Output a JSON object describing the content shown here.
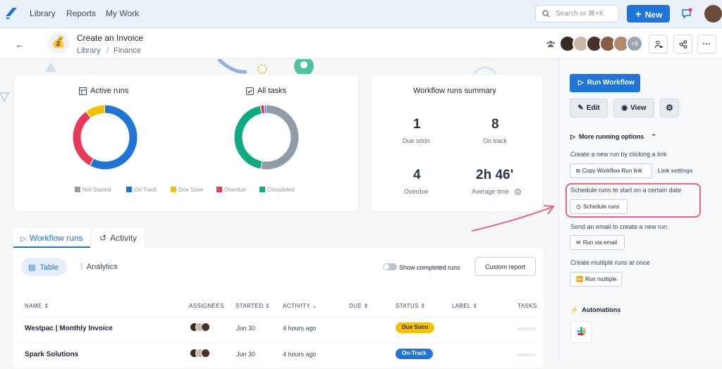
{
  "topbar": {
    "nav": [
      "Library",
      "Reports",
      "My Work"
    ],
    "search_placeholder": "Search or ⌘+K",
    "new_label": "New"
  },
  "workflow": {
    "title": "Create an Invoice",
    "breadcrumb_root": "Library",
    "breadcrumb_sep": "/",
    "breadcrumb_leaf": "Finance",
    "extra_assignees": "+6"
  },
  "active_runs": {
    "title": "Active runs",
    "segments": [
      {
        "status": "On Track",
        "fraction": 0.58,
        "color": "#1f74d8"
      },
      {
        "status": "Overdue",
        "fraction": 0.32,
        "color": "#e8385a"
      },
      {
        "status": "Due Soon",
        "fraction": 0.1,
        "color": "#f6c000"
      }
    ]
  },
  "all_tasks": {
    "title": "All tasks",
    "segments": [
      {
        "status": "Not Started",
        "fraction": 0.53,
        "color": "#919ca9"
      },
      {
        "status": "Completed",
        "fraction": 0.44,
        "color": "#0faa84"
      },
      {
        "status": "Overdue",
        "fraction": 0.02,
        "color": "#e8385a"
      },
      {
        "status": "On Track",
        "fraction": 0.01,
        "color": "#1f74d8"
      }
    ]
  },
  "legend": [
    {
      "label": "Not Started",
      "color": "#919ca9"
    },
    {
      "label": "On Track",
      "color": "#1f74d8"
    },
    {
      "label": "Due Soon",
      "color": "#f6c000"
    },
    {
      "label": "Overdue",
      "color": "#e8385a"
    },
    {
      "label": "Completed",
      "color": "#0faa84"
    }
  ],
  "summary": {
    "title": "Workflow runs summary",
    "due_soon": {
      "value": "1",
      "label": "Due soon"
    },
    "on_track": {
      "value": "8",
      "label": "On track"
    },
    "overdue": {
      "value": "4",
      "label": "Overdue"
    },
    "average": {
      "value": "2h 46'",
      "label": "Average time"
    }
  },
  "tabs": {
    "runs": "Workflow runs",
    "activity": "Activity"
  },
  "toolbar": {
    "table": "Table",
    "analytics": "Analytics",
    "show_completed": "Show completed runs",
    "custom_report": "Custom report"
  },
  "columns": [
    "NAME",
    "ASSIGNEES",
    "STARTED",
    "ACTIVITY",
    "DUE",
    "STATUS",
    "LABEL",
    "TASKS"
  ],
  "rows": [
    {
      "name": "Westpac | Monthly Invoice",
      "started": "Jun 30",
      "activity": "4 hours ago",
      "status": "Due Soon",
      "status_bg": "#f6c000",
      "status_fg": "#1c2434"
    },
    {
      "name": "Spark Solutions",
      "started": "Jun 30",
      "activity": "4 hours ago",
      "status": "On-Track",
      "status_bg": "#1f74d8",
      "status_fg": "#ffffff"
    }
  ],
  "sidebar": {
    "run_workflow": "Run Workflow",
    "edit": "Edit",
    "view": "View",
    "more_options": "More running options",
    "link_text": "Create a new run by clicking a link",
    "copy_link": "Copy Workflow Run link",
    "link_settings": "Link settings",
    "schedule_text": "Schedule runs to start on a certain date",
    "schedule_btn": "Schedule runs",
    "email_text": "Send an email to create a new run",
    "email_btn": "Run via email",
    "multi_text": "Create multiple runs at once",
    "multi_btn": "Run multiple",
    "automations": "Automations"
  }
}
